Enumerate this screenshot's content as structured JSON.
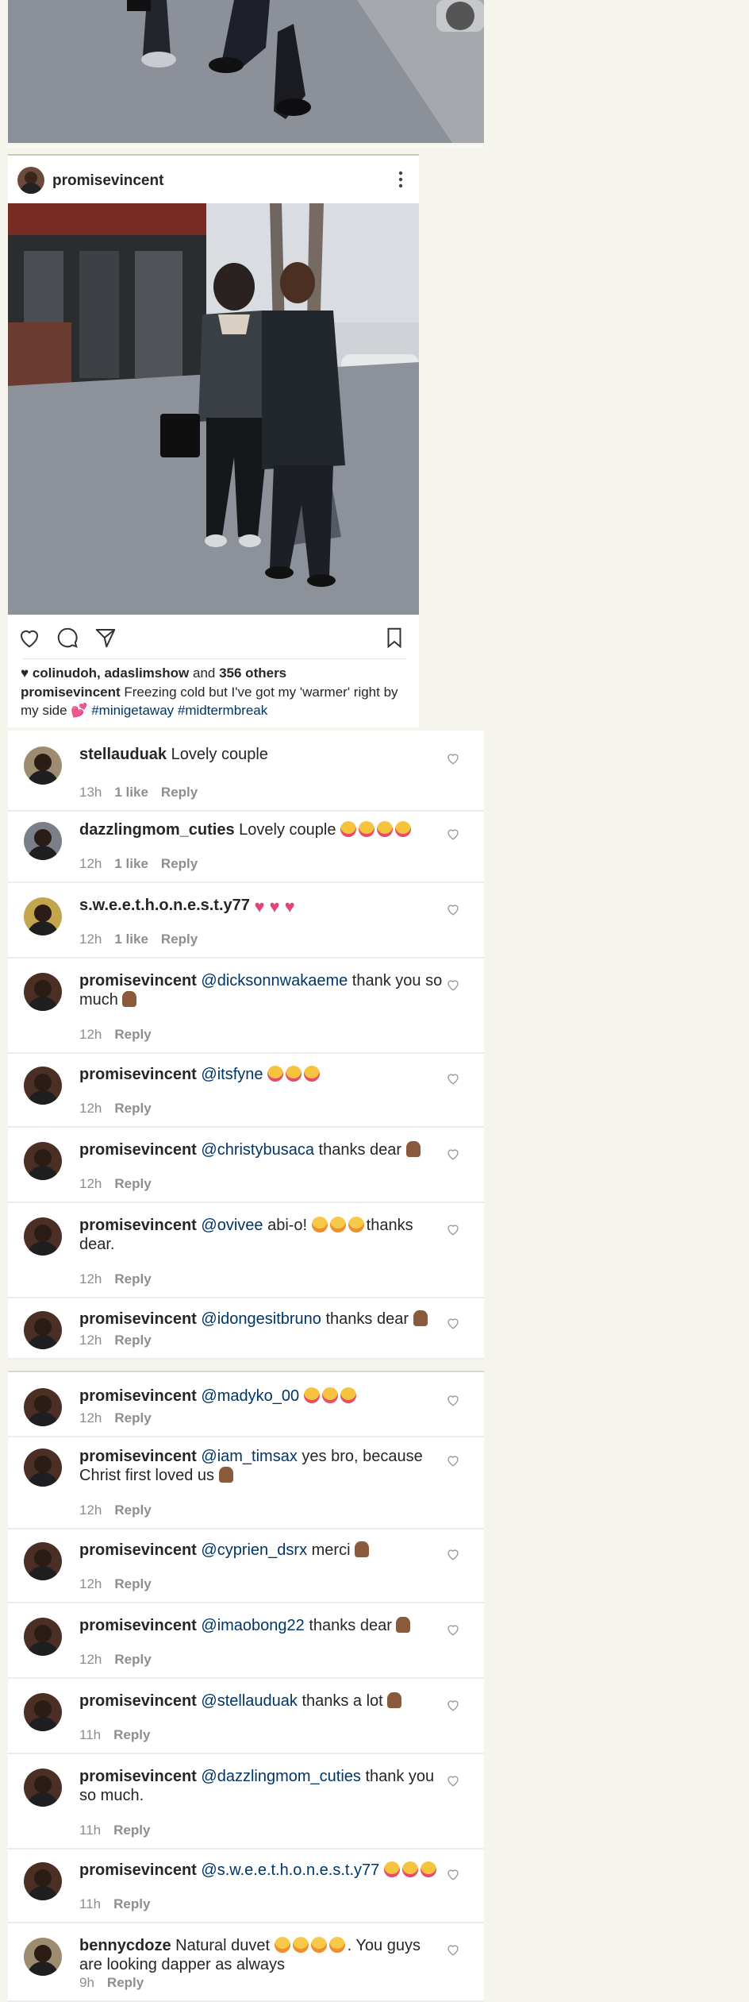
{
  "post": {
    "username": "promisevincent",
    "likes": {
      "names": "colinudoh, adaslimshow",
      "and_text": "and",
      "others": "356 others"
    },
    "caption_username": "promisevincent",
    "caption_text": "Freezing cold but I've got my 'warmer' right by my side 💕",
    "hashtags": "#minigetaway #midtermbreak"
  },
  "labels": {
    "reply": "Reply"
  },
  "comments": [
    {
      "user": "stellauduak",
      "mention": "",
      "text": "Lovely  couple",
      "time": "13h",
      "likes": "1 like",
      "emoji": ""
    },
    {
      "user": "dazzlingmom_cuties",
      "mention": "",
      "text": "Lovely couple",
      "time": "12h",
      "likes": "1 like",
      "emoji": "kisses4"
    },
    {
      "user": "s.w.e.e.t.h.o.n.e.s.t.y77",
      "mention": "",
      "text": "",
      "time": "12h",
      "likes": "1 like",
      "emoji": "hearts3"
    },
    {
      "user": "promisevincent",
      "mention": "@dicksonnwakaeme",
      "text": "thank you so much",
      "time": "12h",
      "likes": "",
      "emoji": "pray"
    },
    {
      "user": "promisevincent",
      "mention": "@itsfyne",
      "text": "",
      "time": "12h",
      "likes": "",
      "emoji": "kiss3"
    },
    {
      "user": "promisevincent",
      "mention": "@christybusaca",
      "text": "thanks dear",
      "time": "12h",
      "likes": "",
      "emoji": "pray"
    },
    {
      "user": "promisevincent",
      "mention": "@ovivee",
      "text": "abi-o!",
      "text_after": "thanks dear.",
      "time": "12h",
      "likes": "",
      "emoji": "laugh3"
    },
    {
      "user": "promisevincent",
      "mention": "@idongesitbruno",
      "text": "thanks dear",
      "time": "12h",
      "likes": "",
      "emoji": "pray"
    },
    {
      "user": "promisevincent",
      "mention": "@madyko_00",
      "text": "",
      "time": "12h",
      "likes": "",
      "emoji": "kiss3"
    },
    {
      "user": "promisevincent",
      "mention": "@iam_timsax",
      "text": "yes bro, because Christ first loved us",
      "time": "12h",
      "likes": "",
      "emoji": "pray"
    },
    {
      "user": "promisevincent",
      "mention": "@cyprien_dsrx",
      "text": "merci",
      "time": "12h",
      "likes": "",
      "emoji": "pray"
    },
    {
      "user": "promisevincent",
      "mention": "@imaobong22",
      "text": "thanks dear",
      "time": "12h",
      "likes": "",
      "emoji": "pray"
    },
    {
      "user": "promisevincent",
      "mention": "@stellauduak",
      "text": "thanks a lot",
      "time": "11h",
      "likes": "",
      "emoji": "pray"
    },
    {
      "user": "promisevincent",
      "mention": "@dazzlingmom_cuties",
      "text": "thank you so much.",
      "time": "11h",
      "likes": "",
      "emoji": ""
    },
    {
      "user": "promisevincent",
      "mention": "@s.w.e.e.t.h.o.n.e.s.t.y77",
      "text": "",
      "time": "11h",
      "likes": "",
      "emoji": "kiss3"
    },
    {
      "user": "bennycdoze",
      "mention": "",
      "text": "Natural duvet",
      "text_after": ". You guys are looking dapper as always",
      "time": "9h",
      "likes": "",
      "emoji": "laugh4"
    }
  ]
}
